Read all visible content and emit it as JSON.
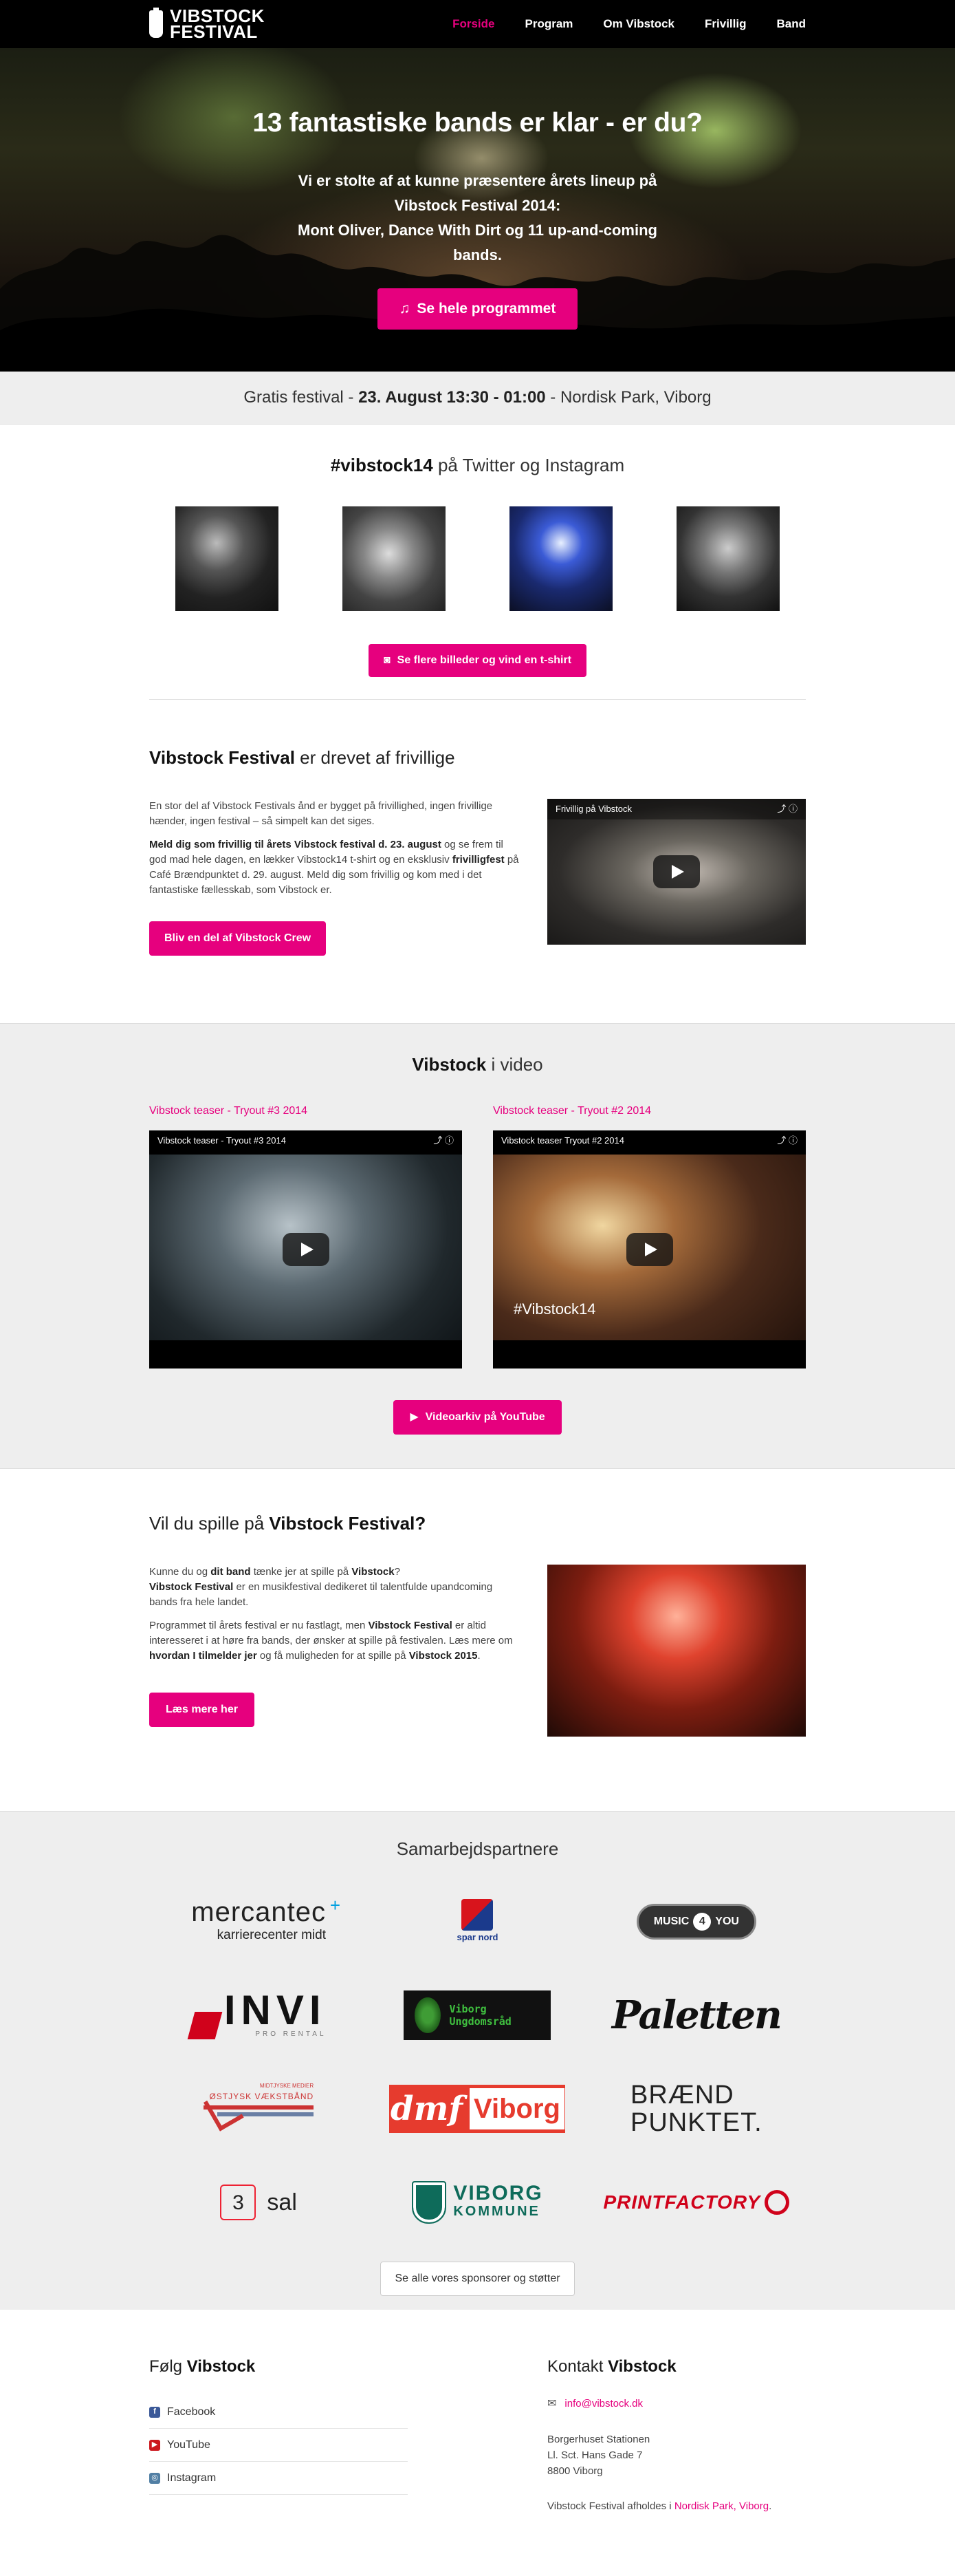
{
  "nav": {
    "logo_line1": "VIBSTOCK",
    "logo_line2": "FESTIVAL",
    "items": [
      {
        "label": "Forside",
        "active": true
      },
      {
        "label": "Program",
        "active": false
      },
      {
        "label": "Om Vibstock",
        "active": false
      },
      {
        "label": "Frivillig",
        "active": false
      },
      {
        "label": "Band",
        "active": false
      }
    ]
  },
  "hero": {
    "title": "13 fantastiske bands er klar - er du?",
    "text_line1": "Vi er stolte af at kunne præsentere årets lineup på Vibstock Festival 2014:",
    "text_line2": "Mont Oliver, Dance With Dirt og 11 up-and-coming bands.",
    "button": "Se hele programmet",
    "button_icon": "music-note-icon"
  },
  "infobar": {
    "prefix": "Gratis festival - ",
    "when": "23. August 13:30 - 01:00",
    "suffix": " - Nordisk Park, Viborg"
  },
  "social": {
    "hashtag": "#vibstock14",
    "rest": " på Twitter og Instagram",
    "button": "Se flere billeder og vind en t-shirt",
    "button_icon": "camera-icon"
  },
  "volunteer": {
    "title_bold": "Vibstock Festival",
    "title_rest": " er drevet af frivillige",
    "p1": "En stor del af Vibstock Festivals ånd er bygget på frivillighed, ingen frivillige hænder, ingen festival – så simpelt kan det siges.",
    "p2_bold": "Meld dig som frivillig til årets Vibstock festival d. 23. august",
    "p2_mid": " og se frem til god mad hele dagen, en lækker Vibstock14 t-shirt og en eksklusiv ",
    "p2_bold2": "frivilligfest",
    "p2_end": " på Café Brændpunktet d. 29. august. Meld dig som frivillig og kom med i det fantastiske fællesskab, som Vibstock er.",
    "button": "Bliv en del af Vibstock Crew",
    "video_title": "Frivillig på Vibstock"
  },
  "videos": {
    "title_bold": "Vibstock",
    "title_rest": " i video",
    "items": [
      {
        "link": "Vibstock teaser - Tryout #3 2014",
        "title": "Vibstock teaser - Tryout #3 2014"
      },
      {
        "link": "Vibstock teaser - Tryout #2 2014",
        "title": "Vibstock teaser Tryout #2 2014",
        "tag": "#Vibstock14"
      }
    ],
    "button": "Videoarkiv på YouTube",
    "button_icon": "youtube-icon"
  },
  "play": {
    "title_pre": "Vil du spille på ",
    "title_bold": "Vibstock Festival?",
    "p1_a": "Kunne du og ",
    "p1_b": "dit band",
    "p1_c": " tænke jer at spille på ",
    "p1_d": "Vibstock",
    "p1_e": "?",
    "p2_a": "Vibstock Festival",
    "p2_b": " er en musikfestival dedikeret til talentfulde upandcoming bands fra hele landet.",
    "p3_a": "Programmet til årets festival er nu fastlagt, men ",
    "p3_b": "Vibstock Festival",
    "p3_c": " er altid interesseret i at høre fra bands, der ønsker at spille på festivalen. Læs mere om ",
    "p3_d": "hvordan I tilmelder jer",
    "p3_e": " og få muligheden for at spille på ",
    "p3_f": "Vibstock 2015",
    "p3_g": ".",
    "button": "Læs mere her"
  },
  "partners": {
    "title": "Samarbejdspartnere",
    "logos": [
      {
        "name": "mercantec",
        "text": "mercantec",
        "sub": "karrierecenter midt"
      },
      {
        "name": "spar-nord",
        "text": "spar nord"
      },
      {
        "name": "music-4-you",
        "text": "MUSIC",
        "mid": "4",
        "end": "YOU"
      },
      {
        "name": "invi",
        "text": "INVI",
        "sub": "PRO RENTAL"
      },
      {
        "name": "viborg-ungdomsraad",
        "text": "Viborg",
        "sub": "Ungdomsråd"
      },
      {
        "name": "paletten",
        "text": "Paletten"
      },
      {
        "name": "ostjysk-vaekstband",
        "text": "ØSTJYSK VÆKSTBÅND",
        "sub": "MIDTJYSKE MEDIER"
      },
      {
        "name": "dmf-viborg",
        "text": "dmf",
        "sub": "Viborg"
      },
      {
        "name": "braendpunktet",
        "text": "BRÆND",
        "sub": "PUNKTET."
      },
      {
        "name": "3-sal",
        "text": "3",
        "sub": "sal"
      },
      {
        "name": "viborg-kommune",
        "text": "VIBORG",
        "sub": "KOMMUNE"
      },
      {
        "name": "printfactory",
        "text": "PRINTFACTORY"
      }
    ],
    "button": "Se alle vores sponsorer og støtter"
  },
  "footer": {
    "follow_pre": "Følg ",
    "follow_bold": "Vibstock",
    "links": [
      {
        "label": "Facebook",
        "icon": "facebook-icon",
        "color": "#3b5998"
      },
      {
        "label": "YouTube",
        "icon": "youtube-icon",
        "color": "#cc181e"
      },
      {
        "label": "Instagram",
        "icon": "instagram-icon",
        "color": "#517fa4"
      }
    ],
    "contact_pre": "Kontakt ",
    "contact_bold": "Vibstock",
    "email": "info@vibstock.dk",
    "addr1": "Borgerhuset Stationen",
    "addr2": "Ll. Sct. Hans Gade 7",
    "addr3": "8800 Viborg",
    "held_pre": "Vibstock Festival afholdes i ",
    "held_link": "Nordisk Park, Viborg",
    "held_end": "."
  },
  "colors": {
    "accent": "#e6007e",
    "nav_bg": "#000000",
    "section_gray": "#eeeeee"
  }
}
